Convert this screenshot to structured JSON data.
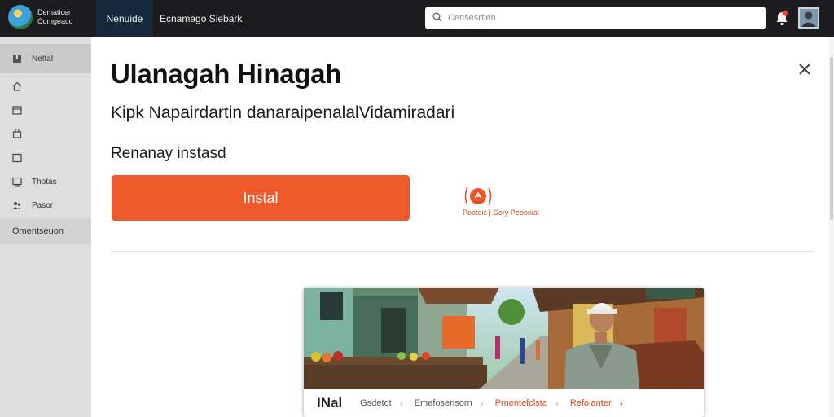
{
  "header": {
    "brand_line1": "Dematicer",
    "brand_line2": "Comgeaco",
    "nav_active": "Nenuide",
    "nav_item": "Ecnamago Siebark",
    "search_placeholder": "Censesrtien"
  },
  "sidebar": {
    "items": [
      {
        "label": "Nettal",
        "icon": "package-icon"
      },
      {
        "label": "",
        "icon": "home-icon"
      },
      {
        "label": "",
        "icon": "calendar-icon"
      },
      {
        "label": "",
        "icon": "bag-icon"
      },
      {
        "label": "",
        "icon": "window-icon"
      },
      {
        "label": "Thotas",
        "icon": "display-icon"
      },
      {
        "label": "Pasor",
        "icon": "group-icon"
      }
    ],
    "section_label": "Omentseuon"
  },
  "main": {
    "title": "Ulanagah Hinagah",
    "subtitle": "Kipk Napairdartin danaraipenalalVidamiradari",
    "install_label_caption": "Renanay instasd",
    "install_button": "Instal",
    "info_text": "Pooteis  |  Cory Peoonial"
  },
  "card": {
    "nav": [
      "INal",
      "Gsdetot",
      "Emefosensorn",
      "Prnentefclsta",
      "Refolanter"
    ]
  },
  "colors": {
    "accent": "#ee5a2b",
    "topbar": "#1c1c1e",
    "nav_active_bg": "#18283c"
  }
}
